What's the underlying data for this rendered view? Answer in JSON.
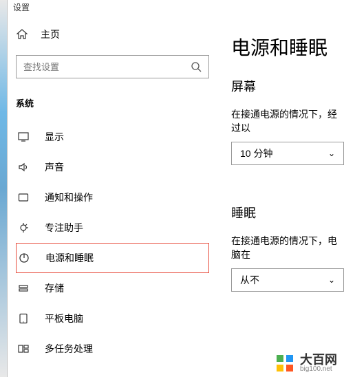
{
  "window": {
    "title": "设置"
  },
  "sidebar": {
    "home_label": "主页",
    "search_placeholder": "查找设置",
    "group_header": "系统",
    "items": [
      {
        "label": "显示"
      },
      {
        "label": "声音"
      },
      {
        "label": "通知和操作"
      },
      {
        "label": "专注助手"
      },
      {
        "label": "电源和睡眠"
      },
      {
        "label": "存储"
      },
      {
        "label": "平板电脑"
      },
      {
        "label": "多任务处理"
      }
    ]
  },
  "main": {
    "page_title": "电源和睡眠",
    "screen": {
      "title": "屏幕",
      "desc": "在接通电源的情况下，经过以",
      "select_value": "10 分钟"
    },
    "sleep": {
      "title": "睡眠",
      "desc": "在接通电源的情况下，电脑在",
      "select_value": "从不"
    }
  },
  "watermark": {
    "main": "大百网",
    "sub": "big100.net"
  }
}
